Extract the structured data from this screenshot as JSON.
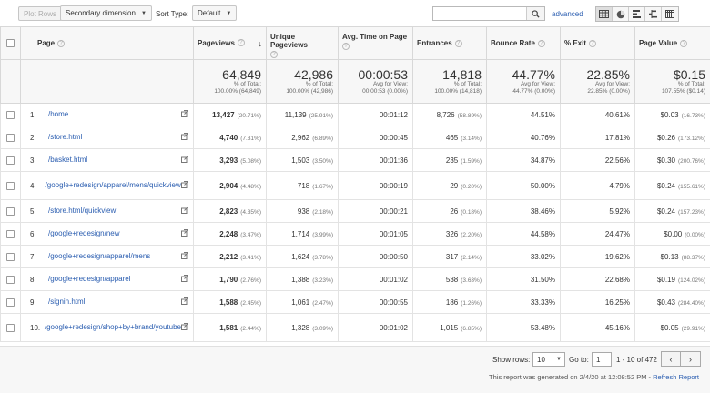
{
  "toolbar": {
    "plot_rows": "Plot Rows",
    "secondary_dimension": "Secondary dimension",
    "sort_type_label": "Sort Type:",
    "sort_type_value": "Default",
    "search_value": "",
    "advanced": "advanced",
    "view_icons": [
      "data-table-icon",
      "pie-chart-icon",
      "performance-icon",
      "comparison-icon",
      "pivot-icon"
    ]
  },
  "table": {
    "headers": {
      "page": "Page",
      "pageviews": "Pageviews",
      "unique_pageviews": "Unique Pageviews",
      "avg_time": "Avg. Time on Page",
      "entrances": "Entrances",
      "bounce_rate": "Bounce Rate",
      "exit": "% Exit",
      "page_value": "Page Value"
    },
    "totals": {
      "pageviews": "64,849",
      "pageviews_sub1": "% of Total:",
      "pageviews_sub2": "100.00% (64,849)",
      "unique_pageviews": "42,986",
      "unique_sub1": "% of Total:",
      "unique_sub2": "100.00% (42,986)",
      "avg_time": "00:00:53",
      "avg_time_sub1": "Avg for View:",
      "avg_time_sub2": "00:00:53 (0.00%)",
      "entrances": "14,818",
      "entrances_sub1": "% of Total:",
      "entrances_sub2": "100.00% (14,818)",
      "bounce_rate": "44.77%",
      "bounce_sub1": "Avg for View:",
      "bounce_sub2": "44.77% (0.00%)",
      "exit": "22.85%",
      "exit_sub1": "Avg for View:",
      "exit_sub2": "22.85% (0.00%)",
      "page_value": "$0.15",
      "page_value_sub1": "% of Total:",
      "page_value_sub2": "107.55% ($0.14)"
    },
    "rows": [
      {
        "num": "1.",
        "page": "/home",
        "pv": "13,427",
        "pv_pct": "(20.71%)",
        "upv": "11,139",
        "upv_pct": "(25.91%)",
        "time": "00:01:12",
        "ent": "8,726",
        "ent_pct": "(58.89%)",
        "bounce": "44.51%",
        "exit": "40.61%",
        "val": "$0.03",
        "val_pct": "(16.73%)"
      },
      {
        "num": "2.",
        "page": "/store.html",
        "pv": "4,740",
        "pv_pct": "(7.31%)",
        "upv": "2,962",
        "upv_pct": "(6.89%)",
        "time": "00:00:45",
        "ent": "465",
        "ent_pct": "(3.14%)",
        "bounce": "40.76%",
        "exit": "17.81%",
        "val": "$0.26",
        "val_pct": "(173.12%)"
      },
      {
        "num": "3.",
        "page": "/basket.html",
        "pv": "3,293",
        "pv_pct": "(5.08%)",
        "upv": "1,503",
        "upv_pct": "(3.50%)",
        "time": "00:01:36",
        "ent": "235",
        "ent_pct": "(1.59%)",
        "bounce": "34.87%",
        "exit": "22.56%",
        "val": "$0.30",
        "val_pct": "(200.76%)"
      },
      {
        "num": "4.",
        "page": "/google+redesign/apparel/mens/quickview",
        "pv": "2,904",
        "pv_pct": "(4.48%)",
        "upv": "718",
        "upv_pct": "(1.67%)",
        "time": "00:00:19",
        "ent": "29",
        "ent_pct": "(0.20%)",
        "bounce": "50.00%",
        "exit": "4.79%",
        "val": "$0.24",
        "val_pct": "(155.61%)"
      },
      {
        "num": "5.",
        "page": "/store.html/quickview",
        "pv": "2,823",
        "pv_pct": "(4.35%)",
        "upv": "938",
        "upv_pct": "(2.18%)",
        "time": "00:00:21",
        "ent": "26",
        "ent_pct": "(0.18%)",
        "bounce": "38.46%",
        "exit": "5.92%",
        "val": "$0.24",
        "val_pct": "(157.23%)"
      },
      {
        "num": "6.",
        "page": "/google+redesign/new",
        "pv": "2,248",
        "pv_pct": "(3.47%)",
        "upv": "1,714",
        "upv_pct": "(3.99%)",
        "time": "00:01:05",
        "ent": "326",
        "ent_pct": "(2.20%)",
        "bounce": "44.58%",
        "exit": "24.47%",
        "val": "$0.00",
        "val_pct": "(0.00%)"
      },
      {
        "num": "7.",
        "page": "/google+redesign/apparel/mens",
        "pv": "2,212",
        "pv_pct": "(3.41%)",
        "upv": "1,624",
        "upv_pct": "(3.78%)",
        "time": "00:00:50",
        "ent": "317",
        "ent_pct": "(2.14%)",
        "bounce": "33.02%",
        "exit": "19.62%",
        "val": "$0.13",
        "val_pct": "(88.37%)"
      },
      {
        "num": "8.",
        "page": "/google+redesign/apparel",
        "pv": "1,790",
        "pv_pct": "(2.76%)",
        "upv": "1,388",
        "upv_pct": "(3.23%)",
        "time": "00:01:02",
        "ent": "538",
        "ent_pct": "(3.63%)",
        "bounce": "31.50%",
        "exit": "22.68%",
        "val": "$0.19",
        "val_pct": "(124.02%)"
      },
      {
        "num": "9.",
        "page": "/signin.html",
        "pv": "1,588",
        "pv_pct": "(2.45%)",
        "upv": "1,061",
        "upv_pct": "(2.47%)",
        "time": "00:00:55",
        "ent": "186",
        "ent_pct": "(1.26%)",
        "bounce": "33.33%",
        "exit": "16.25%",
        "val": "$0.43",
        "val_pct": "(284.40%)"
      },
      {
        "num": "10.",
        "page": "/google+redesign/shop+by+brand/youtube",
        "pv": "1,581",
        "pv_pct": "(2.44%)",
        "upv": "1,328",
        "upv_pct": "(3.09%)",
        "time": "00:01:02",
        "ent": "1,015",
        "ent_pct": "(6.85%)",
        "bounce": "53.48%",
        "exit": "45.16%",
        "val": "$0.05",
        "val_pct": "(29.91%)"
      }
    ]
  },
  "footer": {
    "show_rows_label": "Show rows:",
    "show_rows_value": "10",
    "goto_label": "Go to:",
    "goto_value": "1",
    "range": "1 - 10 of 472",
    "generated": "This report was generated on 2/4/20 at 12:08:52 PM - ",
    "refresh": "Refresh Report"
  },
  "colors": {
    "link": "#2a5db0",
    "header_bg": "#f7f7f7",
    "border": "#e3e3e3"
  }
}
